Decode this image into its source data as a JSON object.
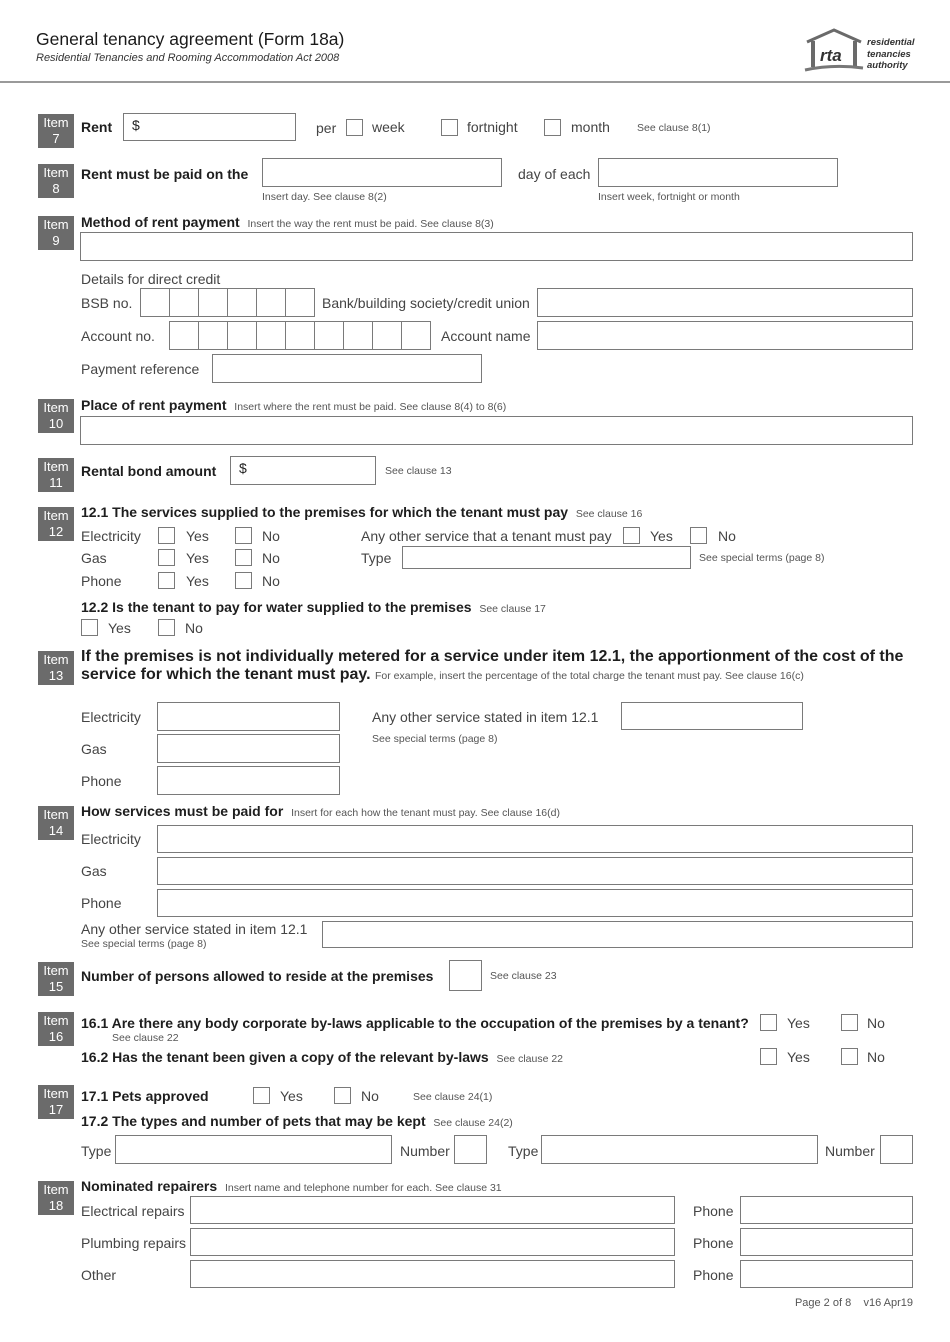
{
  "header": {
    "title_bold": "General tenancy agreement",
    "title_light": " (Form 18a)",
    "subtitle": "Residential Tenancies and Rooming Accommodation Act 2008",
    "logo": {
      "mark": "rta",
      "line1": "residential",
      "line2": "tenancies",
      "line3": "authority"
    }
  },
  "badge_word": "Item",
  "item7": {
    "number": "7",
    "label": "Rent",
    "currency": "$",
    "per": "per",
    "options": [
      "week",
      "fortnight",
      "month"
    ],
    "note": "See clause 8(1)"
  },
  "item8": {
    "number": "8",
    "label": "Rent must be paid on the",
    "day_hint": "Insert day. See clause 8(2)",
    "day_of_each": "day of each",
    "period_hint": "Insert week, fortnight or month"
  },
  "item9": {
    "number": "9",
    "label": "Method of rent payment",
    "note": "Insert the way the rent must be paid. See clause 8(3)",
    "direct_credit": "Details for direct credit",
    "bsb": "BSB no.",
    "bank": "Bank/building society/credit union",
    "account_no": "Account no.",
    "account_name": "Account name",
    "payment_ref": "Payment reference"
  },
  "item10": {
    "number": "10",
    "label": "Place of rent payment",
    "note": "Insert where the rent must be paid. See clause 8(4) to 8(6)"
  },
  "item11": {
    "number": "11",
    "label": "Rental bond amount",
    "currency": "$",
    "note": "See clause 13"
  },
  "item12": {
    "number": "12",
    "q1": "12.1  The services supplied to the premises for which the tenant must pay",
    "q1_note": "See clause 16",
    "services": [
      "Electricity",
      "Gas",
      "Phone"
    ],
    "yes": "Yes",
    "no": "No",
    "other": "Any other service that a tenant must pay",
    "type": "Type",
    "special": "See special terms (page 8)",
    "q2": "12.2  Is the tenant to pay for water supplied to the premises",
    "q2_note": "See clause 17"
  },
  "item13": {
    "number": "13",
    "line1": "If the premises is not individually metered for a service under item 12.1, the apportionment of the cost of the",
    "line2": "service for which the tenant must pay.",
    "note": "For example, insert the percentage of the total charge the tenant must pay. See clause 16(c)",
    "services": [
      "Electricity",
      "Gas",
      "Phone"
    ],
    "other": "Any other service stated in item 12.1",
    "special": "See special terms (page 8)"
  },
  "item14": {
    "number": "14",
    "label": "How services must be paid for",
    "note": "Insert for each how the tenant must pay. See clause 16(d)",
    "services": [
      "Electricity",
      "Gas",
      "Phone"
    ],
    "other": "Any other service stated in item 12.1",
    "special": "See special terms (page 8)"
  },
  "item15": {
    "number": "15",
    "label": "Number of persons allowed to reside at the premises",
    "note": "See clause 23"
  },
  "item16": {
    "number": "16",
    "q1": "16.1 Are there any body corporate by-laws applicable to the occupation of the premises by a tenant?",
    "q1_note": "See clause 22",
    "q2": "16.2 Has the tenant been given a copy of the relevant by-laws",
    "q2_note": "See clause 22",
    "yes": "Yes",
    "no": "No"
  },
  "item17": {
    "number": "17",
    "q1": "17.1  Pets approved",
    "yes": "Yes",
    "no": "No",
    "q1_note": "See clause 24(1)",
    "q2": "17.2  The types and number of pets that may be kept",
    "q2_note": "See clause 24(2)",
    "type": "Type",
    "number_label": "Number"
  },
  "item18": {
    "number": "18",
    "label": "Nominated repairers",
    "note": "Insert name and telephone number for each. See clause 31",
    "rows": [
      "Electrical repairs",
      "Plumbing repairs",
      "Other"
    ],
    "phone": "Phone"
  },
  "footer": {
    "page": "Page 2 of 8",
    "version": "v16 Apr19"
  }
}
